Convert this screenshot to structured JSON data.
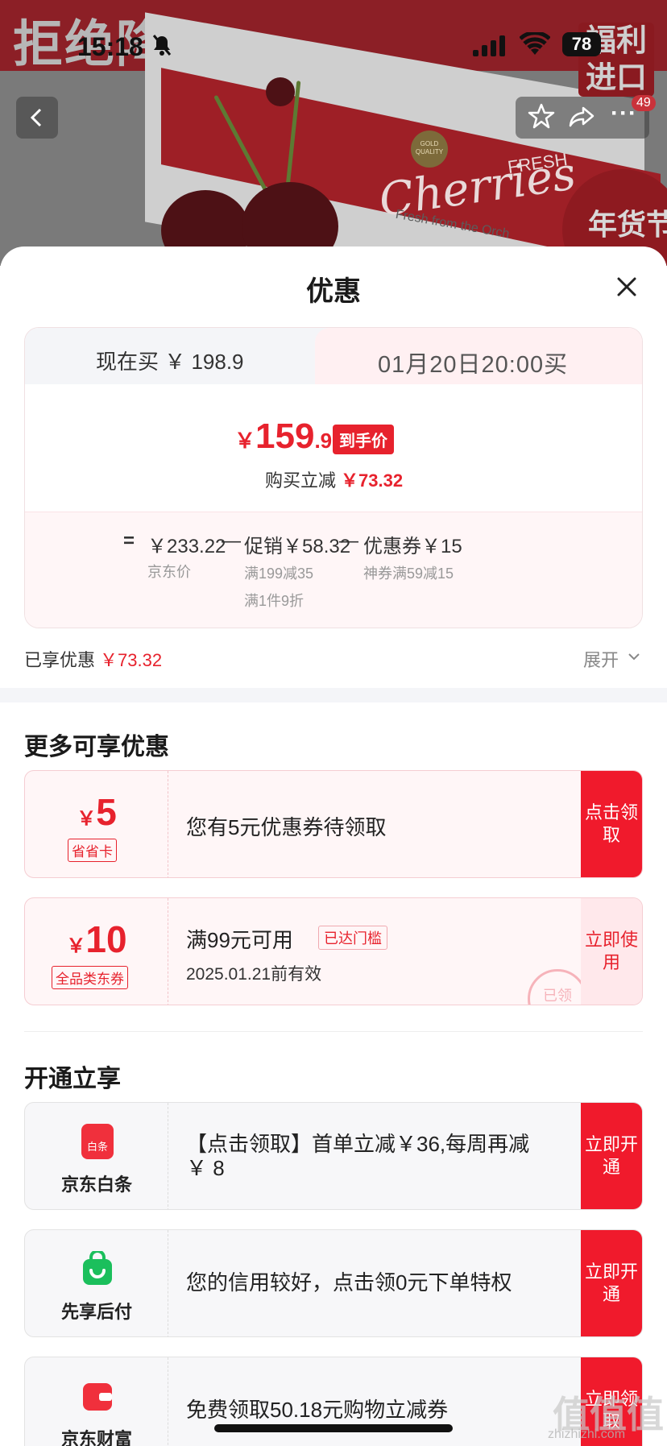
{
  "background": {
    "banner_text": "拒绝降J",
    "corner_badge": "福利进口",
    "product_brand": "Cherries",
    "product_fresh": "FRESH",
    "product_sub": "Fresh from the Orch",
    "gold_quality": "GOLD QUALITY",
    "round_badge": "年货节"
  },
  "status_bar": {
    "time": "15:18",
    "battery": "78"
  },
  "nav": {
    "more": "···",
    "count": "49"
  },
  "sheet": {
    "title": "优惠",
    "tabs": {
      "now": "现在买 ￥ 198.9",
      "later": "01月20日20:00买"
    },
    "final_price": {
      "yen": "￥",
      "int": "159",
      "dec": ".9",
      "tag": "到手价"
    },
    "reduce": {
      "label": "购买立减",
      "value": "￥73.32"
    },
    "calc": {
      "eq": "=",
      "jd_price": "￥233.22",
      "jd_label": "京东价",
      "minus1": "—",
      "promo": "促销￥58.32",
      "promo_note1": "满199减35",
      "promo_note2": "满1件9折",
      "minus2": "—",
      "coupon": "优惠券￥15",
      "coupon_note": "神券满59减15"
    },
    "enjoyed": {
      "label": "已享优惠",
      "value": "￥73.32"
    },
    "expand_label": "展开"
  },
  "more_offers": {
    "title": "更多可享优惠",
    "coupons": [
      {
        "yen": "￥",
        "amount": "5",
        "tag": "省省卡",
        "text": "您有5元优惠券待领取",
        "button": "点击领取"
      },
      {
        "yen": "￥",
        "amount": "10",
        "tag": "全品类东券",
        "text": "满99元可用",
        "chip": "已达门槛",
        "sub": "2025.01.21前有效",
        "button": "立即使用",
        "stamp": "已领"
      }
    ]
  },
  "open_now": {
    "title": "开通立享",
    "services": [
      {
        "name": "京东白条",
        "icon_label": "白条",
        "text_line1": "【点击领取】首单立减￥36,每周再减",
        "text_line2": "￥ 8",
        "button": "立即开通"
      },
      {
        "name": "先享后付",
        "text_line1": "您的信用较好，点击领0元下单特权",
        "button": "立即开通"
      },
      {
        "name": "京东财富",
        "text_line1": "免费领取50.18元购物立减券",
        "button": "立即领取"
      }
    ]
  },
  "watermark": {
    "text": "值值值",
    "sub": "zhizhizhi.com"
  },
  "colors": {
    "accent": "#e7222d",
    "button_red": "#f01a2c",
    "coupon_bg": "#fff6f7"
  }
}
